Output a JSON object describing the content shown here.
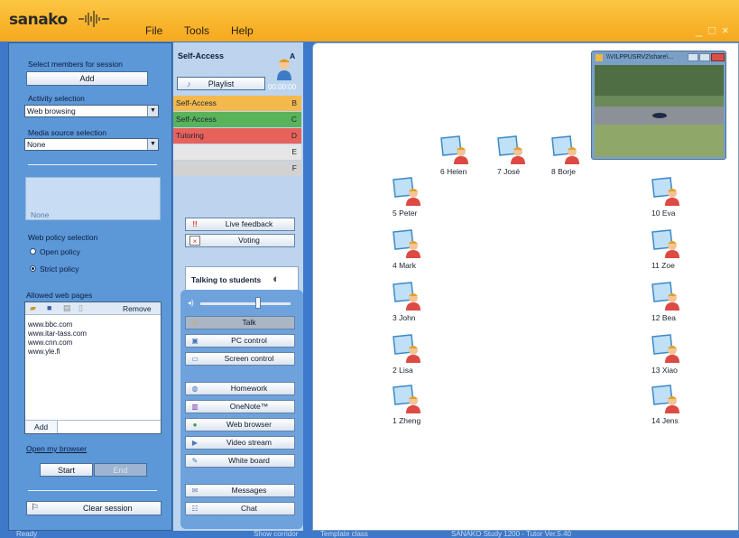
{
  "titlebar": {
    "logo": "sanako",
    "menu": [
      "File",
      "Tools",
      "Help"
    ],
    "controls": [
      "_",
      "□",
      "×"
    ]
  },
  "left": {
    "select_members_label": "Select members for session",
    "add_label": "Add",
    "activity_label": "Activity selection",
    "activity_value": "Web browsing",
    "media_label": "Media source selection",
    "media_value": "None",
    "none_text": "None",
    "web_policy_label": "Web policy selection",
    "open_policy": "Open policy",
    "strict_policy": "Strict policy",
    "allowed_label": "Allowed web pages",
    "remove_label": "Remove",
    "web_pages": [
      "www.bbc.com",
      "www.itar-tass.com",
      "www.cnn.com",
      "www.yle.fi"
    ],
    "add_page_label": "Add",
    "open_browser_label": "Open my browser",
    "start_label": "Start",
    "end_label": "End",
    "clear_session_label": "Clear session"
  },
  "middle": {
    "group_a_title": "Self-Access",
    "group_a_letter": "A",
    "playlist_label": "Playlist",
    "timer": "00:00:00",
    "groups": [
      {
        "name": "Self-Access",
        "letter": "B",
        "color": "#f3b94c"
      },
      {
        "name": "Self-Access",
        "letter": "C",
        "color": "#58b35a"
      },
      {
        "name": "Tutoring",
        "letter": "D",
        "color": "#e8625c"
      },
      {
        "name": "",
        "letter": "E",
        "color": "#e6e6e6"
      },
      {
        "name": "",
        "letter": "F",
        "color": "#d2d2d2"
      }
    ],
    "live_feedback": "Live feedback",
    "voting": "Voting",
    "talking_to": "Talking to students",
    "buttons": [
      {
        "label": "Talk",
        "icon": "talk-icon"
      },
      {
        "label": "PC control",
        "icon": "pc-control-icon"
      },
      {
        "label": "Screen control",
        "icon": "screen-control-icon"
      },
      {
        "label": "Homework",
        "icon": "homework-icon"
      },
      {
        "label": "OneNote™",
        "icon": "onenote-icon"
      },
      {
        "label": "Web browser",
        "icon": "web-browser-icon"
      },
      {
        "label": "Video stream",
        "icon": "video-stream-icon"
      },
      {
        "label": "White board",
        "icon": "white-board-icon"
      },
      {
        "label": "Messages",
        "icon": "messages-icon"
      },
      {
        "label": "Chat",
        "icon": "chat-icon"
      }
    ]
  },
  "students": [
    {
      "name": "6 Helen"
    },
    {
      "name": "7 José"
    },
    {
      "name": "8 Borje"
    },
    {
      "name": "5 Peter"
    },
    {
      "name": "4 Mark"
    },
    {
      "name": "3 John"
    },
    {
      "name": "2 Lisa"
    },
    {
      "name": "1 Zheng"
    },
    {
      "name": "10 Eva"
    },
    {
      "name": "11 Zoe"
    },
    {
      "name": "12 Bea"
    },
    {
      "name": "13 Xiao"
    },
    {
      "name": "14 Jens"
    }
  ],
  "video_window": {
    "title": "\\\\VILPPUSRV2\\share\\..."
  },
  "status": {
    "ready": "Ready",
    "show_corridor": "Show corridor",
    "template": "Template class",
    "version": "SANAKO Study 1200 - Tutor Ver.5.40"
  }
}
